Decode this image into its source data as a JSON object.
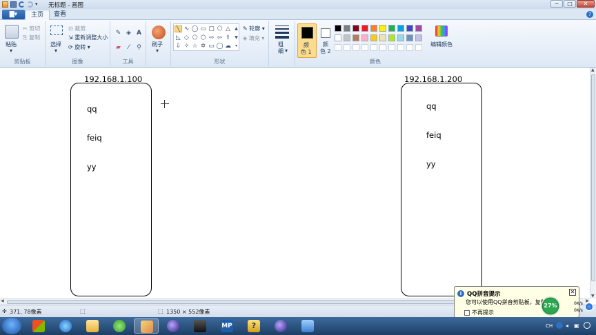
{
  "window": {
    "title": "无标题 - 画图",
    "controls": {
      "minimize": "─",
      "maximize": "□",
      "close": "✕"
    }
  },
  "tabs": {
    "app_menu": "▇▾",
    "home": "主页",
    "view": "查看",
    "help": "?"
  },
  "ribbon": {
    "clipboard": {
      "paste": "粘贴",
      "cut": "剪切",
      "copy": "复制",
      "label": "剪贴板"
    },
    "image": {
      "select": "选择",
      "crop": "裁剪",
      "resize": "重新调整大小",
      "rotate": "旋转",
      "label": "图像"
    },
    "tools": {
      "label": "工具"
    },
    "brushes": {
      "label": "刷子"
    },
    "shapes": {
      "outline": "轮廓",
      "fill": "填充",
      "label": "形状"
    },
    "size": {
      "label_a": "粗",
      "label_b": "细"
    },
    "colors": {
      "color1": "颜",
      "color1b": "色 1",
      "color2": "颜",
      "color2b": "色 2",
      "edit": "编辑颜色",
      "label": "颜色",
      "palette_row1": [
        "#000000",
        "#7f7f7f",
        "#880015",
        "#ed1c24",
        "#ff7f27",
        "#fff200",
        "#22b14c",
        "#00a2e8",
        "#3f48cc",
        "#a349a4"
      ],
      "palette_row2": [
        "#ffffff",
        "#c3c3c3",
        "#b97a57",
        "#ffaec9",
        "#ffc90e",
        "#efe4b0",
        "#b5e61d",
        "#99d9ea",
        "#7092be",
        "#c8bfe7"
      ]
    }
  },
  "canvas": {
    "host_left": {
      "ip": "192.168.1.100",
      "items": [
        "qq",
        "feiq",
        "yy"
      ]
    },
    "host_right": {
      "ip": "192.168.1.200",
      "items": [
        "qq",
        "feiq",
        "yy"
      ]
    }
  },
  "status": {
    "cursor_pos": "371, 78像素",
    "canvas_size": "1350 × 552像素"
  },
  "notification": {
    "title": "QQ拼音提示",
    "body": "您可以使用QQ拼音剪贴板，复制粘贴",
    "checkbox": "不再提示",
    "close": "✕"
  },
  "tray": {
    "gauge": "27%",
    "up": "0K/s",
    "down": "0K/s",
    "lang": "CH"
  },
  "taskbar": {
    "mp_label": "MP"
  }
}
